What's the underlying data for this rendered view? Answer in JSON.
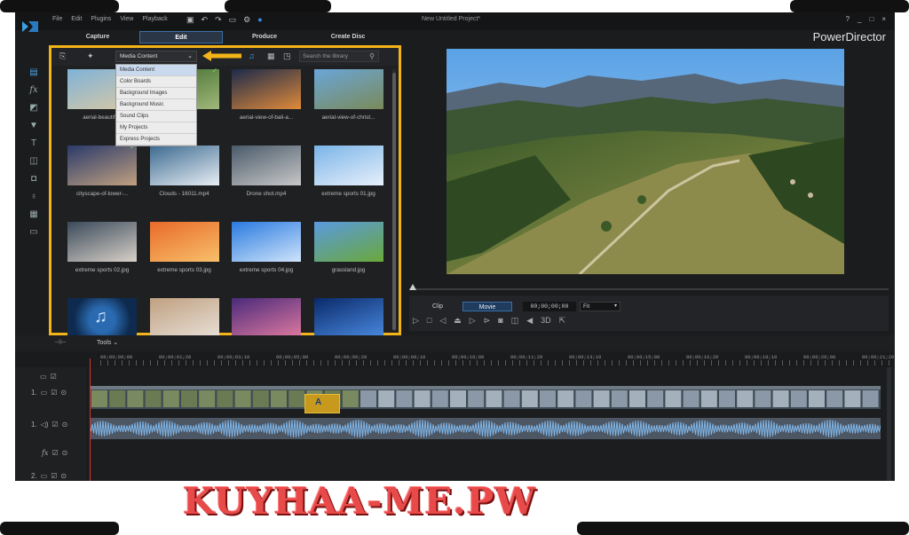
{
  "window": {
    "title": "New Untitled Project*",
    "brand": "PowerDirector",
    "menu": [
      "File",
      "Edit",
      "Plugins",
      "View",
      "Playback"
    ],
    "controls": [
      "?",
      "_",
      "□",
      "×"
    ]
  },
  "modes": [
    {
      "label": "Capture",
      "active": false
    },
    {
      "label": "Edit",
      "active": true
    },
    {
      "label": "Produce",
      "active": false
    },
    {
      "label": "Create Disc",
      "active": false
    }
  ],
  "library": {
    "dropdown_value": "Media Content",
    "search_placeholder": "Search the library",
    "menu_items": [
      "Media Content",
      "Color Boards",
      "Background Images",
      "Background Music",
      "Sound Clips",
      "My Projects",
      "Express Projects"
    ],
    "items": [
      {
        "caption": "aerial-beautiful-",
        "thumb": "beach"
      },
      {
        "caption": "-m...",
        "thumb": "forest"
      },
      {
        "caption": "aerial-view-of-bali-a...",
        "thumb": "sunset"
      },
      {
        "caption": "aerial-view-of-christ...",
        "thumb": "christ"
      },
      {
        "caption": "cityscape-of-lower-...",
        "thumb": "city"
      },
      {
        "caption": "Clouds - 16011.mp4",
        "thumb": "clouds"
      },
      {
        "caption": "Drone shot.mp4",
        "thumb": "drone"
      },
      {
        "caption": "extreme sports 01.jpg",
        "thumb": "bike"
      },
      {
        "caption": "extreme sports 02.jpg",
        "thumb": "moto"
      },
      {
        "caption": "extreme sports 03.jpg",
        "thumb": "surf"
      },
      {
        "caption": "extreme sports 04.jpg",
        "thumb": "sky"
      },
      {
        "caption": "grassland.jpg",
        "thumb": "grass"
      },
      {
        "caption": "",
        "thumb": "music"
      },
      {
        "caption": "",
        "thumb": "runner"
      },
      {
        "caption": "",
        "thumb": "purple"
      },
      {
        "caption": "",
        "thumb": "blue"
      }
    ]
  },
  "preview": {
    "clip_label": "Clip",
    "movie_label": "Movie",
    "timecode": "00;00;00;00",
    "fit_label": "Fit"
  },
  "timeline": {
    "tools_label": "Tools",
    "ruler": [
      "00;00;00;00",
      "00;00;01;20",
      "00;00;03;10",
      "00;00;05;00",
      "00;00;06;20",
      "00;00;08;10",
      "00;00;10;00",
      "00;00;11;20",
      "00;00;13;10",
      "00;00;15;00",
      "00;00;16;20",
      "00;00;18;10",
      "00;00;20;00",
      "00;00;21;20"
    ],
    "tracks": [
      "1.",
      "1.",
      "fx",
      "2."
    ]
  },
  "watermark": "KUYHAA-ME.PW",
  "colors": {
    "highlight": "#f2b418",
    "accent": "#3a6fa8",
    "playhead": "#d8342a",
    "watermark": "#e84a4a"
  }
}
